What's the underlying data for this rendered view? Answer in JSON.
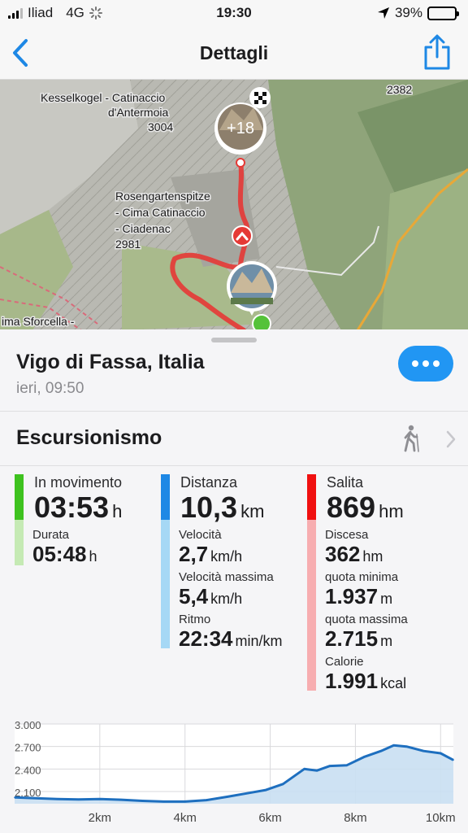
{
  "status_bar": {
    "carrier": "Iliad",
    "network": "4G",
    "time": "19:30",
    "battery": "39%",
    "battery_level": 0.39
  },
  "nav": {
    "title": "Dettagli",
    "back_icon": "chevron-left-icon",
    "share_icon": "share-icon"
  },
  "map": {
    "labels": {
      "peak1_name1": "Kesselkogel - Catinaccio",
      "peak1_name2": "d'Antermoia",
      "peak1_elev": "3004",
      "peak2_name1": "Rosengartenspitze",
      "peak2_name2": "- Cima Catinaccio",
      "peak2_name3": "- Ciadenac",
      "peak2_elev": "2981",
      "pass": "ima Sforcella -",
      "corner_elev": "2382"
    },
    "photo_badge": "+18",
    "route_color": "#e53935"
  },
  "activity": {
    "place": "Vigo di Fassa, Italia",
    "when": "ieri, 09:50",
    "type": "Escursionismo",
    "type_icon": "hiker-icon"
  },
  "stats": {
    "moving": {
      "title": "In movimento",
      "value": "03:53",
      "unit": "h",
      "color": "#3ec21f",
      "light": "#c5eab4"
    },
    "duration": {
      "label": "Durata",
      "value": "05:48",
      "unit": "h"
    },
    "distance": {
      "title": "Distanza",
      "value": "10,3",
      "unit": "km",
      "color": "#1e88e5",
      "light": "#a6d8f5"
    },
    "speed": {
      "label": "Velocità",
      "value": "2,7",
      "unit": "km/h"
    },
    "max_speed": {
      "label": "Velocità massima",
      "value": "5,4",
      "unit": "km/h"
    },
    "pace": {
      "label": "Ritmo",
      "value": "22:34",
      "unit": "min/km"
    },
    "ascent": {
      "title": "Salita",
      "value": "869",
      "unit": "hm",
      "color": "#f01010",
      "light": "#f7adb0"
    },
    "descent": {
      "label": "Discesa",
      "value": "362",
      "unit": "hm"
    },
    "min_alt": {
      "label": "quota minima",
      "value": "1.937",
      "unit": "m"
    },
    "max_alt": {
      "label": "quota massima",
      "value": "2.715",
      "unit": "m"
    },
    "calories": {
      "label": "Calorie",
      "value": "1.991",
      "unit": "kcal"
    }
  },
  "chart_data": {
    "type": "area",
    "ylim": [
      1937,
      3000
    ],
    "xlim": [
      0,
      10.3
    ],
    "y_ticks": [
      "3.000",
      "2.700",
      "2.400",
      "2.100"
    ],
    "y_tick_values": [
      3000,
      2700,
      2400,
      2100
    ],
    "x_ticks": [
      "2km",
      "4km",
      "6km",
      "8km",
      "10km"
    ],
    "x_tick_values": [
      2,
      4,
      6,
      8,
      10
    ],
    "grid": true,
    "line_color": "#1e6fbf",
    "fill_color": "#c9dff2",
    "x": [
      0,
      0.5,
      1,
      1.5,
      2,
      2.5,
      3,
      3.5,
      4,
      4.5,
      5,
      5.5,
      5.9,
      6.3,
      6.8,
      7.1,
      7.4,
      7.8,
      8.2,
      8.6,
      8.9,
      9.2,
      9.6,
      10,
      10.3
    ],
    "values": [
      2020,
      2010,
      2000,
      1995,
      2000,
      1990,
      1975,
      1965,
      1965,
      1985,
      2030,
      2080,
      2120,
      2200,
      2400,
      2380,
      2440,
      2450,
      2560,
      2640,
      2715,
      2700,
      2640,
      2610,
      2520
    ]
  }
}
